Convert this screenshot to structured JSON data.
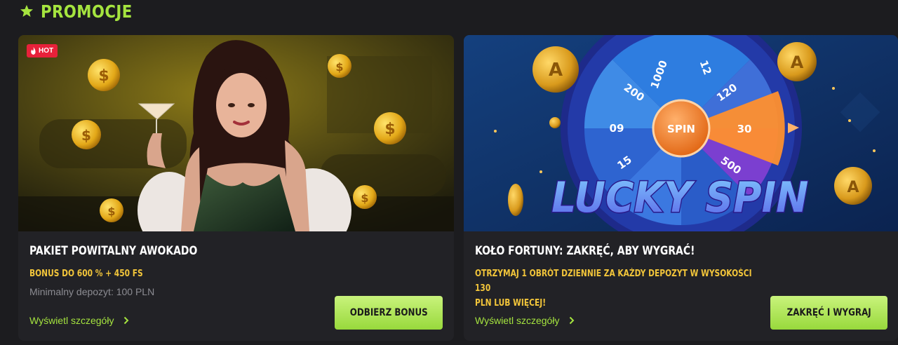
{
  "section": {
    "title": "PROMOCJE",
    "icon": "star-icon"
  },
  "colors": {
    "accent": "#a5e43f",
    "highlight": "#f2c53a",
    "hot": "#e8213a",
    "background": "#1c1c1f",
    "card": "#222226"
  },
  "promos": [
    {
      "badge": "HOT",
      "badge_icon": "fire-icon",
      "title": "PAKIET POWITALNY AWOKADO",
      "subtitle": "BONUS DO 600 % + 450 FS",
      "note": "Minimalny depozyt: 100 PLN",
      "details_label": "Wyświetl szczegóły",
      "cta_label": "ODBIERZ BONUS"
    },
    {
      "title": "KOŁO FORTUNY: ZAKRĘĆ, ABY WYGRAĆ!",
      "subtitle_line1": "OTRZYMAJ 1 OBRÓT DZIENNIE ZA KAŻDY DEPOZYT W WYSOKOŚCI 130",
      "subtitle_line2": "PLN LUB WIĘCEJ!",
      "details_label": "Wyświetl szczegóły",
      "cta_label": "ZAKRĘĆ I WYGRAJ",
      "banner": {
        "heading": "LUCKY SPIN",
        "wheel_center": "SPIN",
        "wheel_values": [
          "1000",
          "12",
          "120",
          "30",
          "500",
          "200",
          "60",
          "15"
        ],
        "coin_letter": "A"
      }
    }
  ]
}
